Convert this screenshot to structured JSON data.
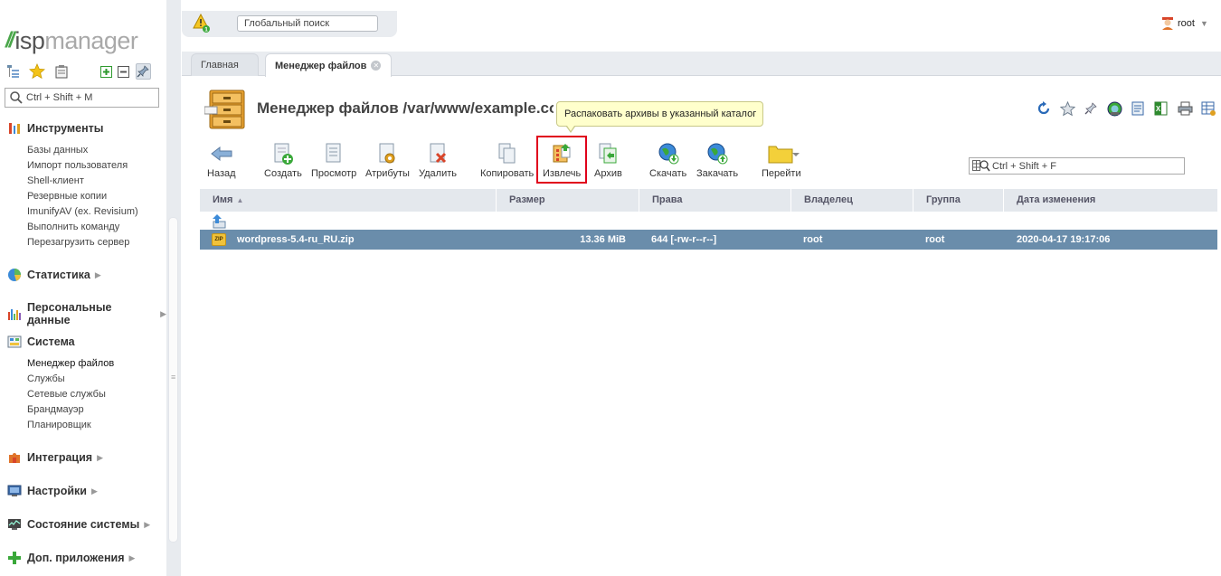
{
  "app": {
    "logo_isp": "isp",
    "logo_manager": "manager"
  },
  "sidebar": {
    "search_placeholder": "Ctrl + Shift + M",
    "sections": {
      "tools": {
        "label": "Инструменты",
        "items": [
          "Базы данных",
          "Импорт пользователя",
          "Shell-клиент",
          "Резервные копии",
          "ImunifyAV (ex. Revisium)",
          "Выполнить команду",
          "Перезагрузить сервер"
        ]
      },
      "stats": {
        "label": "Статистика"
      },
      "personal": {
        "label": "Персональные данные"
      },
      "system": {
        "label": "Система",
        "items": [
          "Менеджер файлов",
          "Службы",
          "Сетевые службы",
          "Брандмауэр",
          "Планировщик"
        ],
        "active": "Менеджер файлов"
      },
      "integration": {
        "label": "Интеграция"
      },
      "settings": {
        "label": "Настройки"
      },
      "status": {
        "label": "Состояние системы"
      },
      "extra": {
        "label": "Доп. приложения"
      }
    }
  },
  "topbar": {
    "warning_count": "1",
    "global_search_placeholder": "Глобальный поиск",
    "user": "root"
  },
  "tabs": {
    "main": "Главная",
    "file_manager": "Менеджер файлов"
  },
  "page": {
    "title": "Менеджер файлов /var/www/example.com",
    "tooltip": "Распаковать архивы в указанный каталог"
  },
  "toolbar": {
    "back": "Назад",
    "create": "Создать",
    "view": "Просмотр",
    "attributes": "Атрибуты",
    "delete": "Удалить",
    "copy": "Копировать",
    "extract": "Извлечь",
    "archive": "Архив",
    "download": "Скачать",
    "upload": "Закачать",
    "goto": "Перейти",
    "list_search_placeholder": "Ctrl + Shift + F"
  },
  "table": {
    "headers": {
      "name": "Имя",
      "size": "Размер",
      "rights": "Права",
      "owner": "Владелец",
      "group": "Группа",
      "modified": "Дата изменения"
    },
    "rows": [
      {
        "name": "wordpress-5.4-ru_RU.zip",
        "size": "13.36 MiB",
        "rights": "644 [-rw-r--r--]",
        "owner": "root",
        "group": "root",
        "modified": "2020-04-17 19:17:06",
        "icon_text": "ZIP"
      }
    ]
  },
  "colors": {
    "accent_green": "#4aa64a",
    "selected_row": "#6a8dab",
    "highlight": "#e0001b",
    "tooltip_bg": "#ffffcc"
  }
}
